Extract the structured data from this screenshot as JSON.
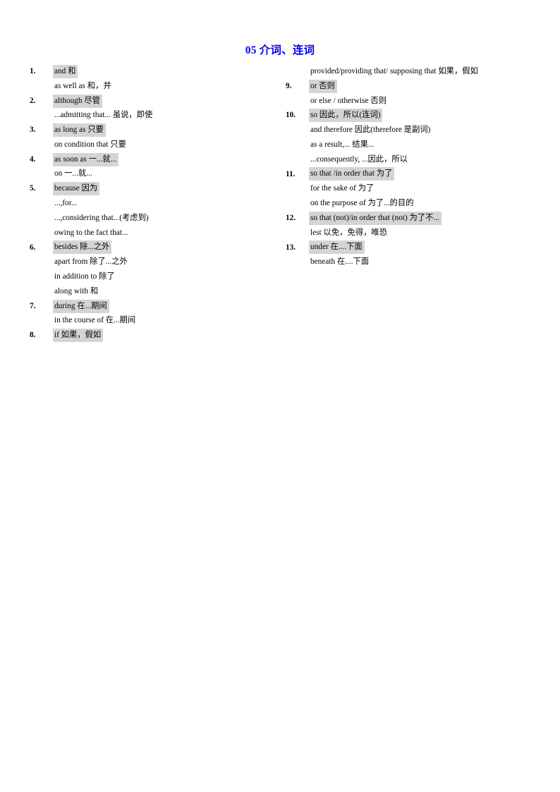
{
  "document": {
    "title": "05 介词、连词",
    "title_color": "#0000ee",
    "highlight_color": "#d4d4d4",
    "page_background": "#ffffff"
  },
  "left_column": [
    {
      "number": "1.",
      "headword": "and  和",
      "highlighted": true,
      "sublines": [
        "as well as  和，并"
      ]
    },
    {
      "number": "2.",
      "headword": "although  尽管",
      "highlighted": true,
      "sublines": [
        "...admitting  that...  虽说，即使"
      ]
    },
    {
      "number": "3.",
      "headword": "as long as  只要",
      "highlighted": true,
      "sublines": [
        "on condition that  只要"
      ]
    },
    {
      "number": "4.",
      "headword": "as soon as  一...就...",
      "highlighted": true,
      "sublines": [
        "on  一...就..."
      ]
    },
    {
      "number": "5.",
      "headword": "because  因为",
      "highlighted": true,
      "sublines": [
        "...,for...",
        "...,considering  that...(考虑到)",
        "owing to  the fact that..."
      ]
    },
    {
      "number": "6.",
      "headword": "besides  除...之外",
      "highlighted": true,
      "sublines": [
        "apart from 除了...之外",
        "in addition  to 除了",
        "along  with 和"
      ]
    },
    {
      "number": "7.",
      "headword": "during  在...期间",
      "highlighted": true,
      "sublines": [
        "in the course of  在...期间"
      ]
    },
    {
      "number": "8.",
      "headword": "if  如果，假如",
      "highlighted": true,
      "sublines": []
    }
  ],
  "right_column": [
    {
      "number": "",
      "headword": "provided/providing  that/ supposing that  如果，假如",
      "highlighted": false,
      "sublines": []
    },
    {
      "number": "9.",
      "headword": "or  否则",
      "highlighted": true,
      "sublines": [
        "or else / otherwise  否则"
      ]
    },
    {
      "number": "10.",
      "headword": "so  因此，所以(连词)",
      "highlighted": true,
      "sublines": [
        "and therefore   因此(therefore 是副词)",
        "as a result,...  结果...",
        "...consequently, ...因此，所以"
      ]
    },
    {
      "number": "11.",
      "headword": "so that /in order that  为了",
      "highlighted": true,
      "sublines": [
        "for the sake of  为了",
        "on the purpose of  为了...的目的"
      ]
    },
    {
      "number": "12.",
      "headword": "so that (not)/in order that (not)  为了不...",
      "highlighted": true,
      "sublines": [
        "lest   以免，免得，唯恐"
      ]
    },
    {
      "number": "13.",
      "headword": "under  在....下面",
      "highlighted": true,
      "sublines": [
        "beneath  在....下面"
      ]
    }
  ]
}
